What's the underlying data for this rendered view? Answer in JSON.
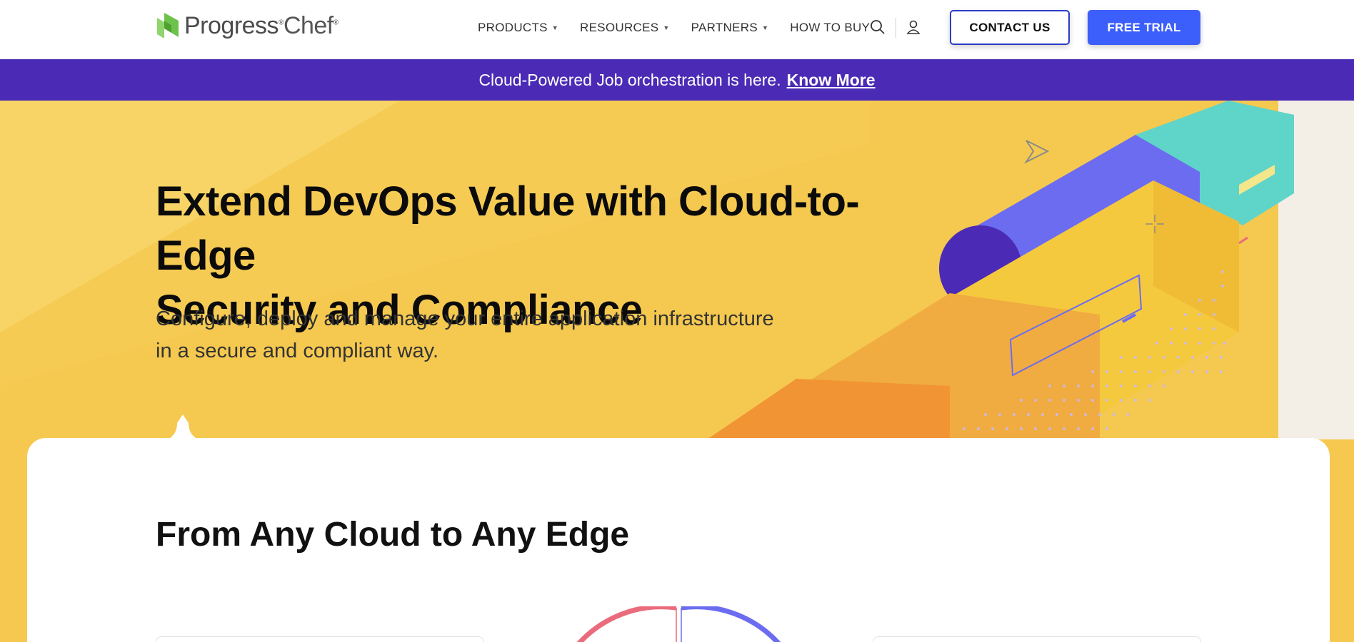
{
  "header": {
    "logo_text": "Progress",
    "logo_suffix": "Chef",
    "nav": [
      {
        "label": "PRODUCTS",
        "has_dropdown": true
      },
      {
        "label": "RESOURCES",
        "has_dropdown": true
      },
      {
        "label": "PARTNERS",
        "has_dropdown": true
      },
      {
        "label": "HOW TO BUY",
        "has_dropdown": false
      }
    ],
    "icons": [
      "search-icon",
      "user-icon"
    ],
    "contact_label": "CONTACT US",
    "trial_label": "FREE TRIAL"
  },
  "banner": {
    "text": "Cloud-Powered Job orchestration is here.",
    "link": "Know More"
  },
  "hero": {
    "title_line1": "Extend DevOps Value with Cloud-to-Edge",
    "title_line2": "Security and Compliance",
    "subtitle_line1": "Configure, deploy and manage your entire application infrastructure",
    "subtitle_line2": "in a secure and compliant way."
  },
  "section": {
    "title": "From Any Cloud to Any Edge"
  },
  "colors": {
    "brand_green": "#6cc24a",
    "banner_purple": "#4b2bb5",
    "primary_blue": "#3c5ffb",
    "hero_yellow": "#f5c94f",
    "accent_teal": "#5fd4c9",
    "accent_violet": "#6b6cf0",
    "accent_orange": "#f19434",
    "accent_pink": "#ea6b7c"
  }
}
